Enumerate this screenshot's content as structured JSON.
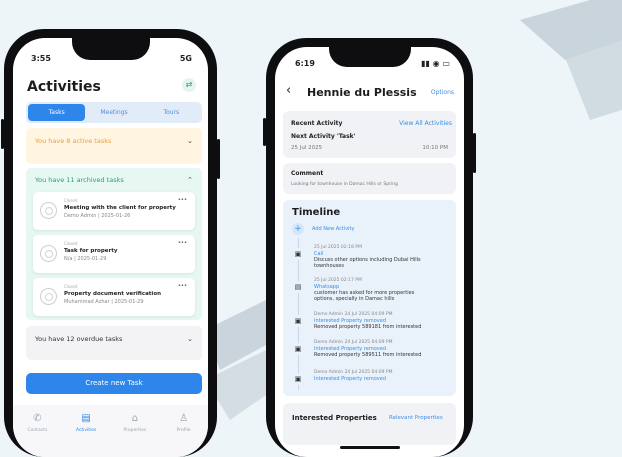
{
  "background": {
    "color": "#eef5f9",
    "accent": "#c9d4dc"
  },
  "left_phone": {
    "status_time": "3:55",
    "status_right": "5G",
    "title": "Activities",
    "tabs": [
      {
        "label": "Tasks",
        "active": true
      },
      {
        "label": "Meetings",
        "active": false
      },
      {
        "label": "Tours",
        "active": false
      }
    ],
    "active_section": {
      "label": "You have 8 active tasks"
    },
    "archived_section": {
      "label": "You have 11 archived tasks"
    },
    "archived_tasks": [
      {
        "status": "Closed",
        "title": "Meeting with the client for property",
        "meta": "Demo Admin  |  2025-01-26"
      },
      {
        "status": "Closed",
        "title": "Task for property",
        "meta": "N/a  |  2025-01-29"
      },
      {
        "status": "Closed",
        "title": "Property document verification",
        "meta": "Muhammad Azhar  |  2025-01-29"
      }
    ],
    "overdue_section": {
      "label": "You have 12 overdue tasks"
    },
    "create_button": "Create new Task",
    "nav": [
      {
        "label": "Contacts",
        "icon": "phone-icon",
        "glyph": "✆",
        "active": false
      },
      {
        "label": "Activities",
        "icon": "activities-icon",
        "glyph": "▤",
        "active": true
      },
      {
        "label": "Properties",
        "icon": "home-icon",
        "glyph": "⌂",
        "active": false
      },
      {
        "label": "Profile",
        "icon": "profile-icon",
        "glyph": "♙",
        "active": false
      }
    ],
    "colors": {
      "primary": "#2f86ea",
      "active_panel": "#fff5e1",
      "archived_panel": "#e7f7f2"
    }
  },
  "right_phone": {
    "status_time": "6:19",
    "header": {
      "back": "‹",
      "title": "Hennie du Plessis",
      "options": "Options"
    },
    "recent_activity": {
      "label": "Recent Activity",
      "link": "View All Activities",
      "next": "Next Activity 'Task'",
      "date": "25 Jul 2025",
      "time": "10:10 PM"
    },
    "comment": {
      "label": "Comment",
      "text": "Looking for townhouse in Damac Hills or Spring"
    },
    "timeline": {
      "title": "Timeline",
      "add_label": "Add New Activity",
      "entries": [
        {
          "icon": "document-icon",
          "glyph": "▣",
          "meta": "25 Jul 2025 02:18 PM",
          "type": "Call",
          "desc": "Discuss other options including Dubai Hills townhouses"
        },
        {
          "icon": "message-icon",
          "glyph": "▤",
          "meta": "25 Jul 2025 02:17 PM",
          "type": "Whatsapp",
          "desc": "customer has asked for more properties options, specially in Damac hills"
        },
        {
          "icon": "document-icon",
          "glyph": "▣",
          "meta": "Demo Admin 24 Jul 2025 04:09 PM",
          "type": "Interested Property removed",
          "desc": "Removed property 589181 from interested"
        },
        {
          "icon": "document-icon",
          "glyph": "▣",
          "meta": "Demo Admin 24 Jul 2025 04:09 PM",
          "type": "Interested Property removed",
          "desc": "Removed property 589511 from interested"
        },
        {
          "icon": "document-icon",
          "glyph": "▣",
          "meta": "Demo Admin 24 Jul 2025 04:09 PM",
          "type": "Interested Property removed",
          "desc": ""
        }
      ]
    },
    "interested": {
      "title": "Interested Properties",
      "link": "Relevant Properties"
    }
  }
}
